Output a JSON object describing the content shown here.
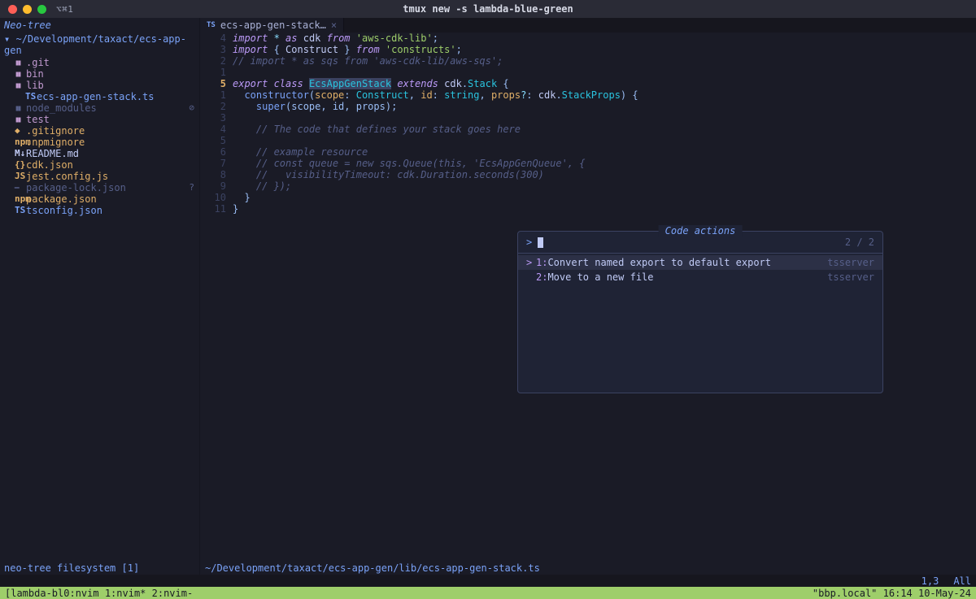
{
  "window": {
    "left_label": "⌥⌘1",
    "title": "tmux new -s lambda-blue-green"
  },
  "sidebar": {
    "title": "Neo-tree",
    "root_icon": "▾",
    "root_path": "~/Development/taxact/ecs-app-gen",
    "items": [
      {
        "depth": 1,
        "mark": "folder",
        "label": ".git",
        "cls": "c-folder"
      },
      {
        "depth": 1,
        "mark": "folder",
        "label": "bin",
        "cls": "c-folder"
      },
      {
        "depth": 1,
        "mark": "folder",
        "label": "lib",
        "cls": "c-folder",
        "open": true
      },
      {
        "depth": 2,
        "mark": "TS",
        "label": "ecs-app-gen-stack.ts",
        "cls": "c-ts"
      },
      {
        "depth": 1,
        "mark": "folder",
        "label": "node_modules",
        "cls": "c-dim",
        "badge": "⊘"
      },
      {
        "depth": 1,
        "mark": "folder",
        "label": "test",
        "cls": "c-folder"
      },
      {
        "depth": 1,
        "mark": "◆",
        "label": ".gitignore",
        "cls": "c-dot"
      },
      {
        "depth": 1,
        "mark": "npm",
        "label": ".npmignore",
        "cls": "c-dot"
      },
      {
        "depth": 1,
        "mark": "M↓",
        "label": "README.md",
        "cls": "c-md"
      },
      {
        "depth": 1,
        "mark": "{}",
        "label": "cdk.json",
        "cls": "c-json"
      },
      {
        "depth": 1,
        "mark": "JS",
        "label": "jest.config.js",
        "cls": "c-js"
      },
      {
        "depth": 1,
        "mark": "⎯",
        "label": "package-lock.json",
        "cls": "c-lock",
        "badge": "?"
      },
      {
        "depth": 1,
        "mark": "npm",
        "label": "package.json",
        "cls": "c-dot"
      },
      {
        "depth": 1,
        "mark": "TS",
        "label": "tsconfig.json",
        "cls": "c-tsb"
      }
    ],
    "status": "neo-tree filesystem [1]"
  },
  "editor": {
    "tab": {
      "icon": "TS",
      "label": "ecs-app-gen-stack…",
      "close": "×"
    },
    "gutter": [
      "4",
      "3",
      "2",
      "1",
      "5",
      "1",
      "2",
      "3",
      "4",
      "5",
      "6",
      "7",
      "8",
      "9",
      "10",
      "11"
    ],
    "gutter_current_index": 4,
    "code": {
      "l1": {
        "a": "import",
        "b": " * ",
        "c": "as",
        "d": " cdk ",
        "e": "from",
        "f": " 'aws-cdk-lib'",
        "g": ";"
      },
      "l2": {
        "a": "import",
        "b": " { ",
        "c": "Construct",
        "d": " } ",
        "e": "from",
        "f": " 'constructs'",
        "g": ";"
      },
      "l3": "// import * as sqs from 'aws-cdk-lib/aws-sqs';",
      "l4": "",
      "l5": {
        "a": "export",
        "b": " class ",
        "c": "EcsAppGenStack",
        "d": " extends ",
        "e": "cdk",
        "f": ".",
        "g": "Stack",
        "h": " {"
      },
      "l6": {
        "a": "  constructor",
        "b": "(",
        "c": "scope",
        "d": ": ",
        "e": "Construct",
        "f": ", ",
        "g": "id",
        "h": ": ",
        "i": "string",
        "j": ", ",
        "k": "props",
        "l": "?",
        "m": ": ",
        "n": "cdk",
        "o": ".",
        "p": "StackProps",
        "q": ") {"
      },
      "l7": {
        "a": "    super",
        "b": "(scope, id, props);"
      },
      "l8": "",
      "l9": "    // The code that defines your stack goes here",
      "l10": "",
      "l11": "    // example resource",
      "l12": "    // const queue = new sqs.Queue(this, 'EcsAppGenQueue', {",
      "l13": "    //   visibilityTimeout: cdk.Duration.seconds(300)",
      "l14": "    // });",
      "l15": "  }",
      "l16": "}"
    },
    "status_path": "~/Development/taxact/ecs-app-gen/lib/ecs-app-gen-stack.ts"
  },
  "popup": {
    "title": "Code actions",
    "prompt": ">",
    "count": "2 / 2",
    "items": [
      {
        "idx": "1:",
        "text": "Convert named export to default export",
        "src": "tsserver",
        "selected": true
      },
      {
        "idx": "2:",
        "text": "Move to a new file",
        "src": "tsserver",
        "selected": false
      }
    ]
  },
  "vimstatus": {
    "left": "",
    "pos": "1,3",
    "pct": "All"
  },
  "tmux": {
    "left": "[lambda-bl0:nvim  1:nvim* 2:nvim-",
    "right": "\"bbp.local\" 16:14 10-May-24"
  }
}
